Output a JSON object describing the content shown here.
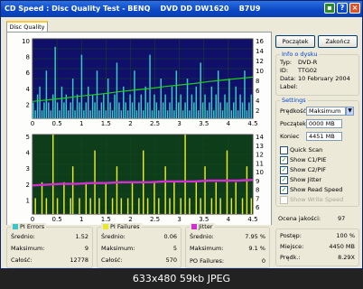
{
  "window": {
    "title": "CD Speed : Disc Quality Test - BENQ    DVD DD DW1620    B7U9"
  },
  "tabs": [
    "Disc Quality"
  ],
  "buttons": {
    "start": "Początek",
    "close": "Zakończ"
  },
  "disc_info": {
    "title": "Info o dysku",
    "rows": [
      {
        "label": "Typ:",
        "value": "DVD-R"
      },
      {
        "label": "ID:",
        "value": "TTG02"
      },
      {
        "label": "Data:",
        "value": "10 February 2004"
      },
      {
        "label": "Label:",
        "value": ""
      }
    ]
  },
  "settings": {
    "title": "Settings",
    "speed_label": "Prędkość",
    "speed_value": "Maksimum",
    "start_label": "Początek",
    "start_value": "0000 MB",
    "end_label": "Koniec",
    "end_value": "4451 MB",
    "checkboxes": [
      {
        "label": "Quick Scan",
        "checked": false,
        "enabled": true
      },
      {
        "label": "Show C1/PIE",
        "checked": true,
        "enabled": true
      },
      {
        "label": "Show C2/PIF",
        "checked": true,
        "enabled": true
      },
      {
        "label": "Show Jitter",
        "checked": true,
        "enabled": true
      },
      {
        "label": "Show Read Speed",
        "checked": true,
        "enabled": true
      },
      {
        "label": "Show Write Speed",
        "checked": false,
        "enabled": false
      }
    ]
  },
  "quality": {
    "label": "Ocena jakości:",
    "value": "97"
  },
  "progress": [
    {
      "label": "Postęp:",
      "value": "100 %"
    },
    {
      "label": "Miejsce:",
      "value": "4450 MB"
    },
    {
      "label": "Prędk.:",
      "value": "8.29X"
    }
  ],
  "pi_errors": {
    "title": "PI Errors",
    "color": "#3cc8c8",
    "rows": [
      {
        "label": "Średnio:",
        "value": "1.52"
      },
      {
        "label": "Maksimum:",
        "value": "9"
      },
      {
        "label": "Całość:",
        "value": "12778"
      }
    ]
  },
  "pi_failures": {
    "title": "PI Failures",
    "color": "#e8e830",
    "rows": [
      {
        "label": "Średnio:",
        "value": "0.06"
      },
      {
        "label": "Maksimum:",
        "value": "5"
      },
      {
        "label": "Całość:",
        "value": "570"
      }
    ]
  },
  "jitter": {
    "title": "Jitter",
    "color": "#d030d0",
    "rows": [
      {
        "label": "Średnio:",
        "value": "7.95 %"
      },
      {
        "label": "Maksimum:",
        "value": "9.1 %"
      }
    ],
    "po_label": "PO Failures:",
    "po_value": "0"
  },
  "caption": "633x480  59kb  JPEG",
  "chart_data": [
    {
      "type": "bar",
      "series": [
        {
          "name": "PI Errors",
          "color": "#3cc8c8",
          "values": [
            2,
            1,
            3,
            4,
            1,
            2,
            6,
            2,
            1,
            3,
            9,
            2,
            1,
            4,
            2,
            3,
            1,
            2,
            5,
            1,
            3,
            2,
            8,
            1,
            2,
            4,
            1,
            3,
            2,
            6,
            1,
            2,
            3,
            1,
            5,
            2,
            1,
            3,
            7,
            2,
            1,
            4,
            2,
            1,
            3,
            2,
            6,
            1,
            2,
            3,
            1,
            4,
            2,
            8,
            1,
            3,
            2,
            1,
            5,
            2,
            3,
            1,
            2,
            4,
            1,
            6,
            2,
            3,
            1,
            2,
            5,
            1,
            3,
            2,
            4,
            1,
            7,
            2,
            3,
            1,
            2,
            4,
            1,
            3,
            6,
            2,
            1,
            3,
            2,
            5,
            1,
            2,
            4,
            1,
            3,
            2,
            6,
            1,
            2,
            3
          ]
        },
        {
          "name": "Read Speed",
          "color": "#20d020",
          "values": [
            3.4,
            3.7,
            4.0,
            4.4,
            4.7,
            5.0,
            5.4,
            5.7,
            6.0,
            6.4,
            6.7,
            7.0,
            7.4,
            7.7,
            8.0,
            8.3
          ]
        }
      ],
      "xlim": [
        0,
        4.5
      ],
      "xticks": [
        "0",
        "0.5",
        "1",
        "1.5",
        "2",
        "2.5",
        "3",
        "3.5",
        "4",
        "4.5"
      ],
      "ylim": [
        0,
        10
      ],
      "yticks_left": [
        "10",
        "8",
        "6",
        "4",
        "2"
      ],
      "yticks_right": [
        "16",
        "14",
        "12",
        "10",
        "8",
        "6",
        "4",
        "2"
      ]
    },
    {
      "type": "bar",
      "series": [
        {
          "name": "PI Failures",
          "color": "#e8e830",
          "values": [
            0,
            1,
            0,
            0,
            2,
            0,
            1,
            0,
            0,
            5,
            0,
            1,
            0,
            0,
            2,
            0,
            0,
            1,
            3,
            0,
            0,
            1,
            0,
            0,
            2,
            0,
            1,
            0,
            4,
            0,
            1,
            0,
            0,
            2,
            0,
            0,
            1,
            0,
            3,
            0,
            1,
            0,
            0,
            1,
            0,
            2,
            0,
            0,
            1,
            0,
            4,
            0,
            1,
            0,
            0,
            2,
            0,
            1,
            0,
            0,
            3,
            0,
            1,
            0,
            2,
            0,
            0,
            1,
            0,
            5,
            0,
            1,
            0,
            0,
            2,
            0,
            1,
            0,
            3,
            0,
            0,
            1,
            0,
            2,
            0,
            1,
            0,
            0,
            4,
            0,
            1,
            0,
            2,
            0,
            0,
            1,
            0,
            3,
            0,
            1
          ]
        },
        {
          "name": "Jitter",
          "color": "#d030d0",
          "values": [
            7.6,
            7.7,
            7.8,
            7.8,
            7.9,
            7.9,
            8.0,
            8.0,
            8.0,
            8.1,
            8.1,
            8.1,
            8.2,
            8.2,
            8.2,
            8.3
          ]
        }
      ],
      "xlim": [
        0,
        4.5
      ],
      "xticks": [
        "0",
        "0.5",
        "1",
        "1.5",
        "2",
        "2.5",
        "3",
        "3.5",
        "4",
        "4.5"
      ],
      "ylim": [
        0,
        5
      ],
      "yticks_left": [
        "5",
        "4",
        "3",
        "2",
        "1"
      ],
      "yticks_right": [
        "14",
        "13",
        "12",
        "11",
        "10",
        "9",
        "8",
        "7",
        "6"
      ]
    }
  ]
}
